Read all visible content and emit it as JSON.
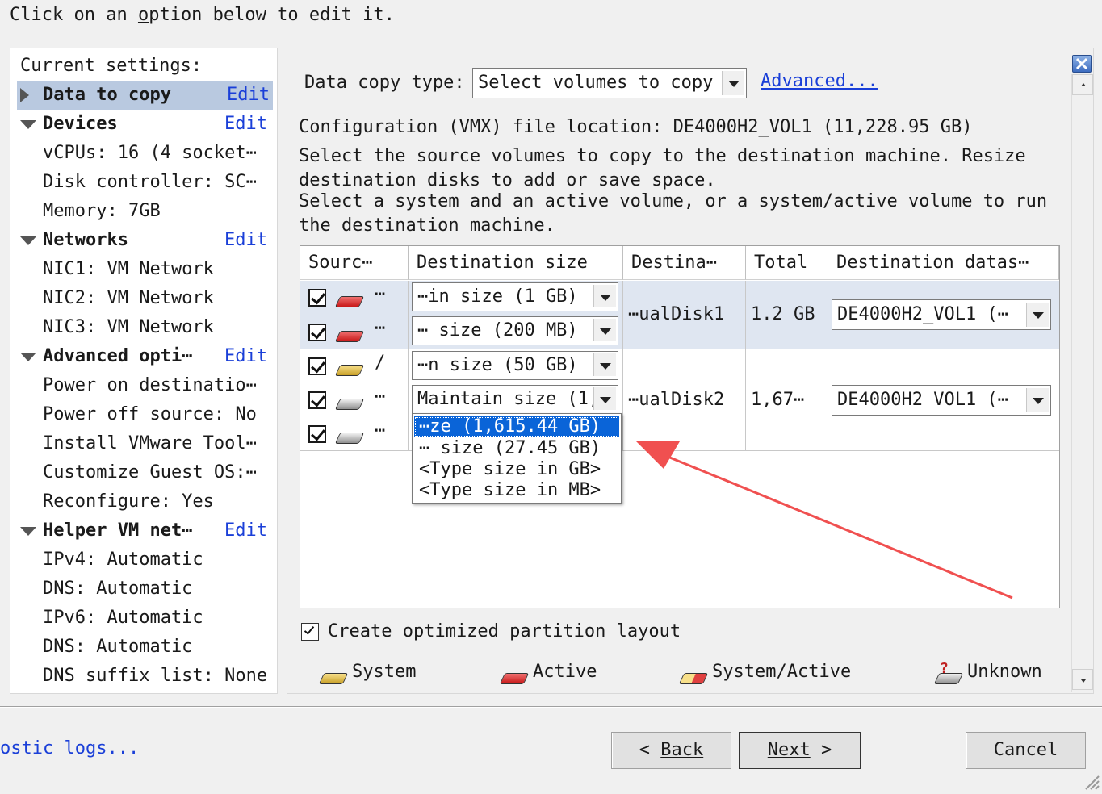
{
  "instruction": "Click on an option below to edit it.",
  "left_panel": {
    "header": "Current settings:",
    "edit_label": "Edit",
    "sections": [
      {
        "title": "Data to copy",
        "items": []
      },
      {
        "title": "Devices",
        "items": [
          "vCPUs: 16 (4 socket⋯",
          "Disk controller: SC⋯",
          "Memory: 7GB"
        ]
      },
      {
        "title": "Networks",
        "items": [
          "NIC1: VM Network",
          "NIC2: VM Network",
          "NIC3: VM Network"
        ]
      },
      {
        "title": "Advanced opti⋯",
        "items": [
          "Power on destinatio⋯",
          "Power off source: No",
          "Install VMware Tool⋯",
          "Customize Guest OS:⋯",
          "Reconfigure: Yes"
        ]
      },
      {
        "title": "Helper VM net⋯",
        "items": [
          "IPv4: Automatic",
          "DNS: Automatic",
          "IPv6: Automatic",
          "DNS: Automatic",
          "DNS suffix list: None"
        ]
      }
    ]
  },
  "main": {
    "copy_type_label": "Data copy type:",
    "copy_type_value": "Select volumes to copy",
    "advanced_link": "Advanced...",
    "config_location": "Configuration (VMX) file location: DE4000H2_VOL1 (11,228.95 GB)",
    "desc1_line1": "Select the source volumes to copy to the destination machine. Resize",
    "desc1_line2": "destination disks to add or save space.",
    "desc2_line1": "Select a system and an active volume, or a system/active volume to run",
    "desc2_line2": "the destination machine.",
    "table": {
      "headers": [
        "Sourc⋯",
        "Destination size",
        "Destina⋯",
        "Total",
        "Destination datas⋯"
      ],
      "groups": [
        {
          "disk": "⋯ualDisk1",
          "total": "1.2 GB",
          "datastore": "DE4000H2_VOL1 (⋯",
          "rows": [
            {
              "source": "⋯",
              "size": "⋯in size (1 GB)"
            },
            {
              "source": "⋯",
              "size": "⋯ size (200 MB)"
            }
          ]
        },
        {
          "disk": "⋯ualDisk2",
          "total": "1,67⋯",
          "datastore": "DE4000H2 VOL1 (⋯",
          "rows": [
            {
              "source": "/",
              "size": "⋯n size (50 GB)"
            },
            {
              "source": "⋯",
              "size": "Maintain size (1,⋯"
            },
            {
              "source": "⋯",
              "size": ""
            }
          ]
        }
      ],
      "dropdown_options": [
        "⋯ze (1,615.44 GB)",
        "⋯ size (27.45 GB)",
        "<Type size in GB>",
        "<Type size in MB>"
      ]
    },
    "optimized_layout_label": "Create optimized partition layout",
    "legend": [
      "System",
      "Active",
      "System/Active",
      "Unknown"
    ]
  },
  "footer": {
    "logs_link": "ostic logs...",
    "back": "Back",
    "next": "Next",
    "cancel": "Cancel"
  }
}
